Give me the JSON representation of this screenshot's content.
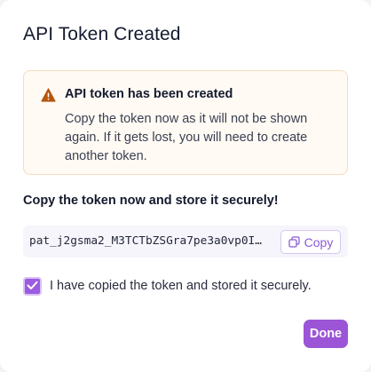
{
  "dialog": {
    "title": "API Token Created"
  },
  "alert": {
    "icon": "warning-icon",
    "title": "API token has been created",
    "body": "Copy the token now as it will not be shown again. If it gets lost, you will need to create another token.",
    "accent_color": "#b5560d"
  },
  "token": {
    "section_label": "Copy the token now and store it securely!",
    "value": "pat_j2gsma2_M3TCTbZSGra7pe3a0vp0I…",
    "copy_label": "Copy",
    "copy_icon": "copy-icon"
  },
  "confirmation": {
    "checked": true,
    "label": "I have copied the token and stored it securely."
  },
  "actions": {
    "done_label": "Done",
    "accent_color": "#9b55d6"
  }
}
